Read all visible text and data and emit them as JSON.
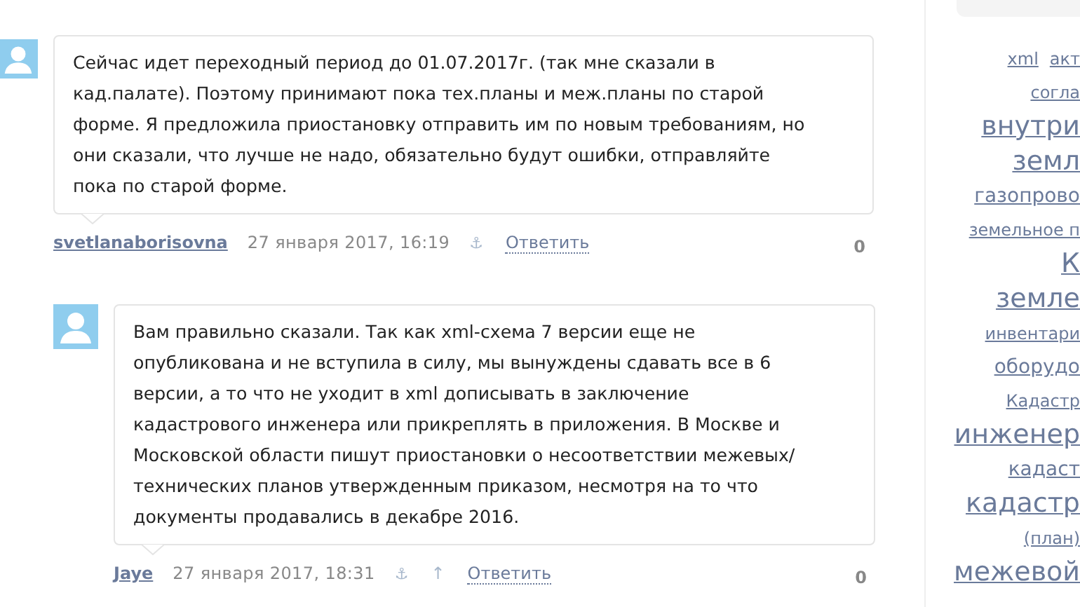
{
  "comments": [
    {
      "indent": false,
      "text": "Сейчас идет переходный период до 01.07.2017г. (так мне сказали в\nкад.палате). Поэтому принимают пока тех.планы и меж.планы по старой\nформе. Я предложила приостановку отправить им по новым требованиям, но\nони сказали, что лучше не надо, обязательно будут ошибки, отправляйте\nпока по старой форме.",
      "author": "svetlanaborisovna",
      "date": "27 января 2017, 16:19",
      "anchor": "⚓",
      "parent_link": false,
      "reply": "Ответить",
      "score": "0"
    },
    {
      "indent": true,
      "text": "Вам правильно сказали. Так как xml-схема 7 версии еще не\nопубликована и не вступила в силу, мы вынуждены сдавать все в 6\nверсии, а то что не уходит в xml дописывать в заключение\nкадастрового инженера или прикреплять в приложения. В Москве и\nМосковской области пишут приостановки о несоответствии межевых/\nтехнических планов утвержденным приказом, несмотря на то что\nдокументы продавались в декабре 2016.",
      "author": "Jaye",
      "date": "27 января 2017, 18:31",
      "anchor": "⚓",
      "parent_link": true,
      "parent_arrow": "↑",
      "reply": "Ответить",
      "score": "0"
    }
  ],
  "tag_cloud": [
    [
      {
        "label": "xml",
        "kind": "minor"
      },
      {
        "label": "акт",
        "kind": "minor"
      }
    ],
    [
      {
        "label": "согла",
        "kind": "minor"
      }
    ],
    [
      {
        "label": "внутри",
        "kind": "major"
      }
    ],
    [
      {
        "label": "земл",
        "kind": "major"
      }
    ],
    [
      {
        "label": "газопрово",
        "kind": "common"
      }
    ],
    [
      {
        "label": "земельное п",
        "kind": "minor"
      }
    ],
    [
      {
        "label": "К",
        "kind": "major"
      }
    ],
    [
      {
        "label": "земле",
        "kind": "major"
      }
    ],
    [
      {
        "label": "инвентари",
        "kind": "minor"
      }
    ],
    [
      {
        "label": "оборудо",
        "kind": "common"
      }
    ],
    [
      {
        "label": "Кадастр",
        "kind": "minor"
      }
    ],
    [
      {
        "label": "инженер",
        "kind": "major"
      }
    ],
    [
      {
        "label": "кадаст",
        "kind": "common"
      }
    ],
    [
      {
        "label": "кадастр",
        "kind": "major"
      }
    ],
    [
      {
        "label": "(план)",
        "kind": "minor"
      }
    ],
    [
      {
        "label": "межевой",
        "kind": "major"
      }
    ]
  ]
}
